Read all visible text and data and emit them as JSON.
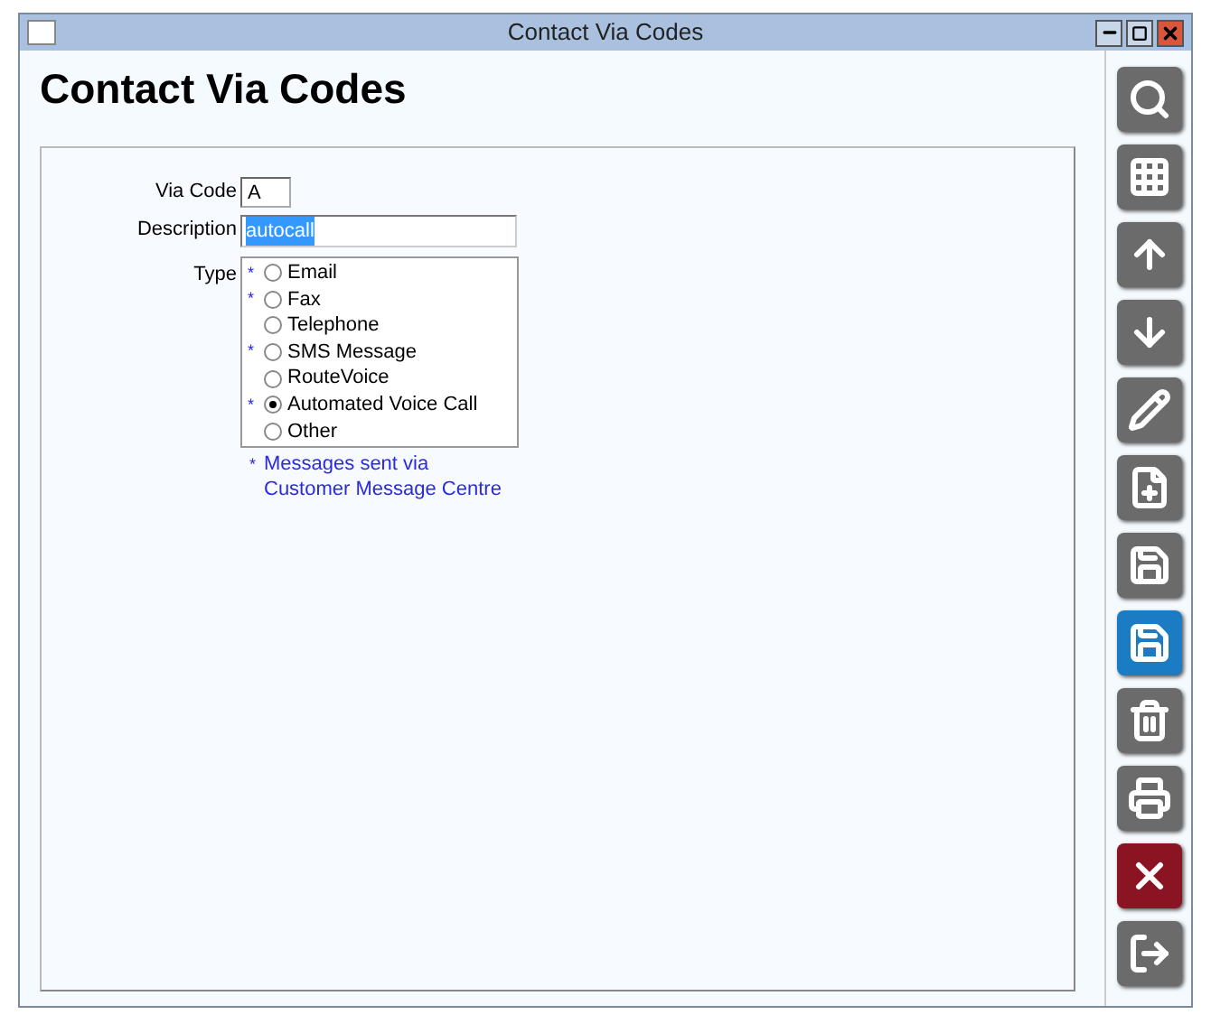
{
  "window": {
    "title": "Contact Via Codes"
  },
  "heading": "Contact Via Codes",
  "form": {
    "via_code": {
      "label": "Via Code",
      "value": "A"
    },
    "description": {
      "label": "Description",
      "value": "autocall",
      "text_selected": true
    },
    "type": {
      "label": "Type",
      "options": [
        {
          "label": "Email",
          "starred": true,
          "selected": false
        },
        {
          "label": "Fax",
          "starred": true,
          "selected": false
        },
        {
          "label": "Telephone",
          "starred": false,
          "selected": false
        },
        {
          "label": "SMS Message",
          "starred": true,
          "selected": false
        },
        {
          "label": "RouteVoice",
          "starred": false,
          "selected": false
        },
        {
          "label": "Automated Voice Call",
          "starred": true,
          "selected": true
        },
        {
          "label": "Other",
          "starred": false,
          "selected": false
        }
      ]
    },
    "note": {
      "mark": "*",
      "lines": [
        "Messages sent via",
        "Customer Message Centre"
      ]
    }
  },
  "toolbar": [
    {
      "kind": "search"
    },
    {
      "kind": "grid"
    },
    {
      "kind": "up"
    },
    {
      "kind": "down"
    },
    {
      "kind": "edit"
    },
    {
      "kind": "new"
    },
    {
      "kind": "save-new"
    },
    {
      "kind": "save"
    },
    {
      "kind": "delete"
    },
    {
      "kind": "print"
    },
    {
      "kind": "cancel"
    },
    {
      "kind": "exit"
    }
  ]
}
